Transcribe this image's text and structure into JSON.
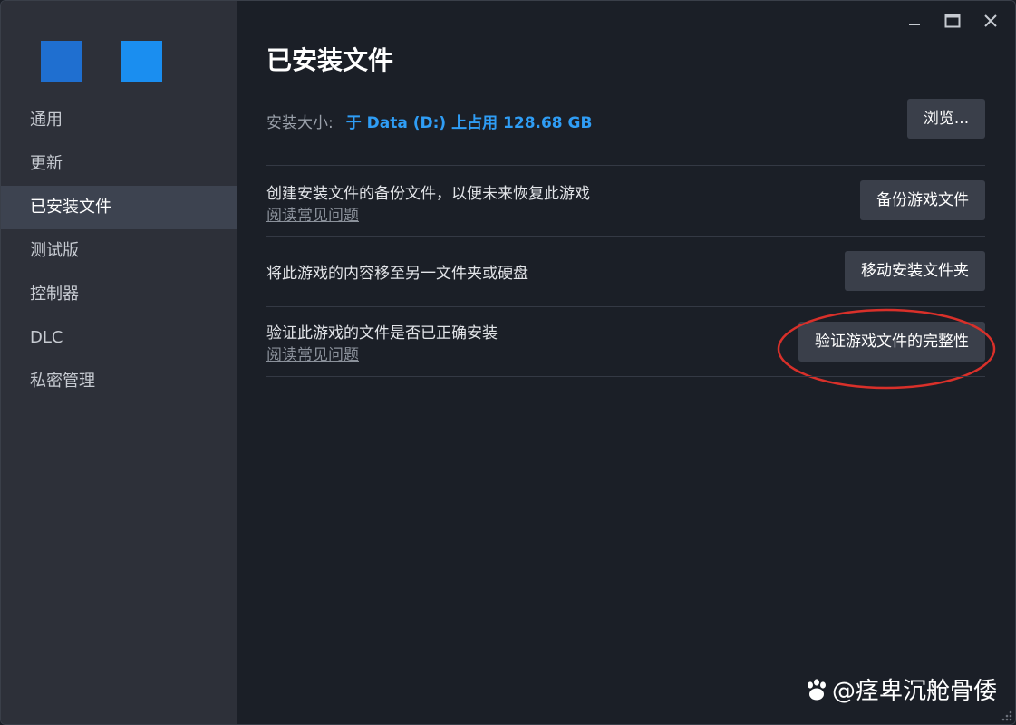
{
  "sidebar": {
    "items": [
      {
        "label": "通用"
      },
      {
        "label": "更新"
      },
      {
        "label": "已安装文件"
      },
      {
        "label": "测试版"
      },
      {
        "label": "控制器"
      },
      {
        "label": "DLC"
      },
      {
        "label": "私密管理"
      }
    ],
    "active_index": 2
  },
  "main": {
    "title": "已安装文件",
    "install_size_label": "安装大小:",
    "install_size_value": "于 Data (D:) 上占用 128.68 GB",
    "browse_label": "浏览...",
    "backup": {
      "text": "创建安装文件的备份文件，以便未来恢复此游戏",
      "link": "阅读常见问题",
      "button": "备份游戏文件"
    },
    "move": {
      "text": "将此游戏的内容移至另一文件夹或硬盘",
      "button": "移动安装文件夹"
    },
    "verify": {
      "text": "验证此游戏的文件是否已正确安装",
      "link": "阅读常见问题",
      "button": "验证游戏文件的完整性"
    }
  },
  "window_controls": [
    "minimize-icon",
    "maximize-icon",
    "close-icon"
  ],
  "watermark": {
    "text": "@痉卑沉舱骨倭"
  },
  "colors": {
    "sidebar_bg": "#2d3039",
    "main_bg": "#1b1f27",
    "accent": "#2f9df5",
    "button_bg": "#3a3f4a",
    "highlight": "#d9302a"
  }
}
